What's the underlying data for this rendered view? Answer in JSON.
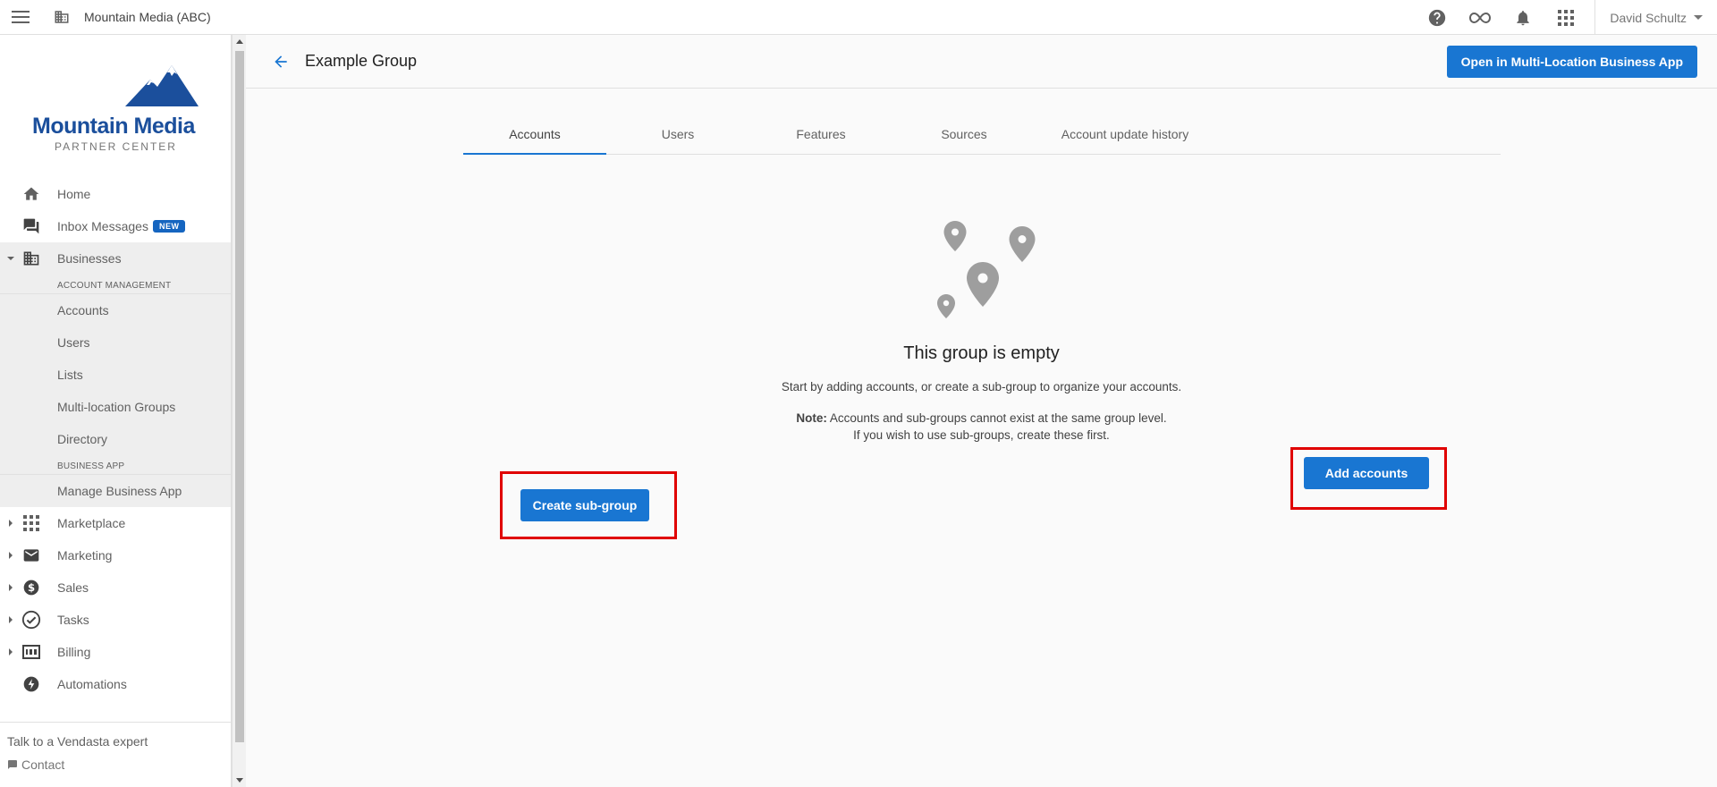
{
  "topbar": {
    "brand_name": "Mountain Media (ABC)",
    "user_name": "David Schultz",
    "icons": [
      "help-icon",
      "infinity-icon",
      "bell-icon",
      "apps-grid-icon"
    ]
  },
  "sidebar": {
    "logo_text": "Mountain Media",
    "subtitle": "PARTNER CENTER",
    "items": [
      {
        "label": "Home",
        "icon": "home-icon"
      },
      {
        "label": "Inbox Messages",
        "icon": "chat-icon",
        "badge": "NEW"
      },
      {
        "label": "Businesses",
        "icon": "building-icon",
        "expanded": true
      },
      {
        "label": "Marketplace",
        "icon": "grid-icon"
      },
      {
        "label": "Marketing",
        "icon": "mail-icon"
      },
      {
        "label": "Sales",
        "icon": "dollar-icon"
      },
      {
        "label": "Tasks",
        "icon": "check-circle-icon"
      },
      {
        "label": "Billing",
        "icon": "billing-icon"
      },
      {
        "label": "Automations",
        "icon": "bolt-icon"
      }
    ],
    "businesses_sections": {
      "account_management_heading": "ACCOUNT MANAGEMENT",
      "account_management_items": [
        "Accounts",
        "Users",
        "Lists",
        "Multi-location Groups",
        "Directory"
      ],
      "business_app_heading": "BUSINESS APP",
      "business_app_items": [
        "Manage Business App"
      ]
    },
    "footer": {
      "talk": "Talk to a Vendasta expert",
      "contact": "Contact"
    }
  },
  "main": {
    "page_title": "Example Group",
    "open_button": "Open in Multi-Location Business App",
    "tabs": [
      "Accounts",
      "Users",
      "Features",
      "Sources",
      "Account update history"
    ],
    "active_tab": "Accounts",
    "empty_state": {
      "title": "This group is empty",
      "description": "Start by adding accounts, or create a sub-group to organize your accounts.",
      "note_label": "Note:",
      "note_line1": "Accounts and sub-groups cannot exist at the same group level.",
      "note_line2": "If you wish to use sub-groups, create these first."
    },
    "create_subgroup_button": "Create sub-group",
    "add_accounts_button": "Add accounts"
  },
  "colors": {
    "primary": "#1976d2",
    "highlight": "#e00000",
    "logo_blue": "#1b4f9c",
    "badge": "#1565c0"
  }
}
